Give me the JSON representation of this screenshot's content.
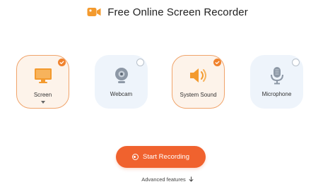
{
  "app": {
    "title": "Free Online Screen Recorder",
    "logo_icon": "video-camera-icon"
  },
  "sources": [
    {
      "label": "Screen",
      "icon": "monitor-icon",
      "selected": true,
      "has_dropdown": true
    },
    {
      "label": "Webcam",
      "icon": "webcam-icon",
      "selected": false,
      "has_dropdown": false
    },
    {
      "label": "System Sound",
      "icon": "speaker-icon",
      "selected": true,
      "has_dropdown": false
    },
    {
      "label": "Microphone",
      "icon": "microphone-icon",
      "selected": false,
      "has_dropdown": false
    }
  ],
  "start_button": {
    "label": "Start Recording",
    "icon": "record-icon"
  },
  "advanced": {
    "label": "Advanced features",
    "icon": "arrow-down-icon"
  },
  "colors": {
    "accent": "#f0622e",
    "selected_border": "#f0a36a",
    "selected_bg": "#fdf3ea",
    "unselected_bg": "#eef4fb",
    "check_fill": "#f0822d"
  }
}
